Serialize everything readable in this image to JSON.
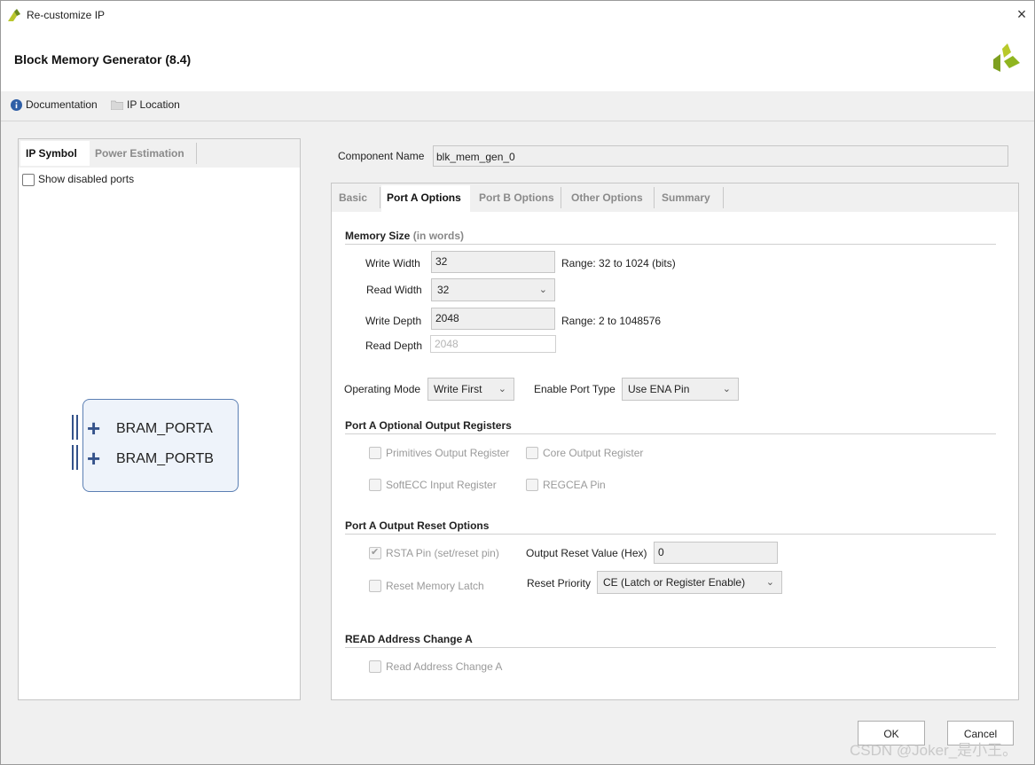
{
  "window": {
    "title": "Re-customize IP",
    "close_icon": "×"
  },
  "header": {
    "title": "Block Memory Generator (8.4)",
    "documentation": "Documentation",
    "ip_location": "IP Location"
  },
  "left_panel": {
    "tabs": [
      "IP Symbol",
      "Power Estimation"
    ],
    "show_disabled_ports": "Show disabled ports",
    "symbol": {
      "ports": [
        "BRAM_PORTA",
        "BRAM_PORTB"
      ]
    }
  },
  "component": {
    "label": "Component Name",
    "value": "blk_mem_gen_0"
  },
  "tabs": [
    "Basic",
    "Port A Options",
    "Port B Options",
    "Other Options",
    "Summary"
  ],
  "memory_size": {
    "title": "Memory Size",
    "subtitle": "(in words)",
    "write_width": {
      "label": "Write Width",
      "value": "32",
      "range": "Range: 32 to 1024 (bits)"
    },
    "read_width": {
      "label": "Read Width",
      "value": "32"
    },
    "write_depth": {
      "label": "Write Depth",
      "value": "2048",
      "range": "Range: 2 to 1048576"
    },
    "read_depth": {
      "label": "Read Depth",
      "value": "2048"
    }
  },
  "operating_mode": {
    "label": "Operating Mode",
    "value": "Write First"
  },
  "enable_port_type": {
    "label": "Enable Port Type",
    "value": "Use ENA Pin"
  },
  "optional_output_registers": {
    "title": "Port A Optional Output Registers",
    "primitives": "Primitives Output Register",
    "core": "Core Output Register",
    "softecc": "SoftECC Input Register",
    "regcea": "REGCEA Pin"
  },
  "output_reset": {
    "title": "Port A Output Reset Options",
    "rsta_pin": "RSTA Pin (set/reset pin)",
    "output_reset_value": {
      "label": "Output Reset Value (Hex)",
      "value": "0"
    },
    "reset_memory_latch": "Reset Memory Latch",
    "reset_priority": {
      "label": "Reset Priority",
      "value": "CE (Latch or Register Enable)"
    }
  },
  "read_address_change": {
    "title": "READ Address Change A",
    "checkbox": "Read Address Change A"
  },
  "buttons": {
    "ok": "OK",
    "cancel": "Cancel"
  },
  "watermark": "CSDN @Joker_是小王。",
  "colors": {
    "accent_logo": "#8fb51f",
    "port_blue": "#34528a"
  }
}
